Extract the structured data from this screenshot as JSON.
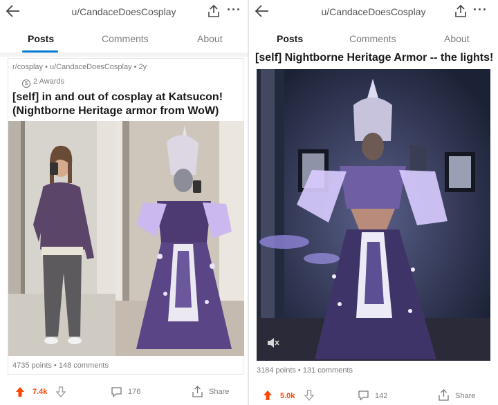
{
  "left": {
    "username": "u/CandaceDoesCosplay",
    "tabs": [
      "Posts",
      "Comments",
      "About"
    ],
    "meta": "r/cosplay • u/CandaceDoesCosplay • 2y",
    "awards": "2 Awards",
    "title_line1": "[self] in and out of cosplay at Katsucon!",
    "title_line2": "(Nightborne Heritage armor from WoW)",
    "stats": "4735 points • 148 comments",
    "upvotes": "7.4k",
    "comments": "176",
    "share": "Share"
  },
  "right": {
    "username": "u/CandaceDoesCosplay",
    "tabs": [
      "Posts",
      "Comments",
      "About"
    ],
    "title": "[self] Nightborne Heritage Armor -- the lights!",
    "stats": "3184 points • 131 comments",
    "upvotes": "5.0k",
    "comments": "142",
    "share": "Share"
  },
  "colors": {
    "accent": "#0079d3",
    "upvote": "#ff4500",
    "muted": "#7c7c7c"
  },
  "icons": [
    "back-arrow-icon",
    "share-icon",
    "more-icon",
    "award-icon",
    "upvote-icon",
    "downvote-icon",
    "comment-icon",
    "mute-icon"
  ]
}
